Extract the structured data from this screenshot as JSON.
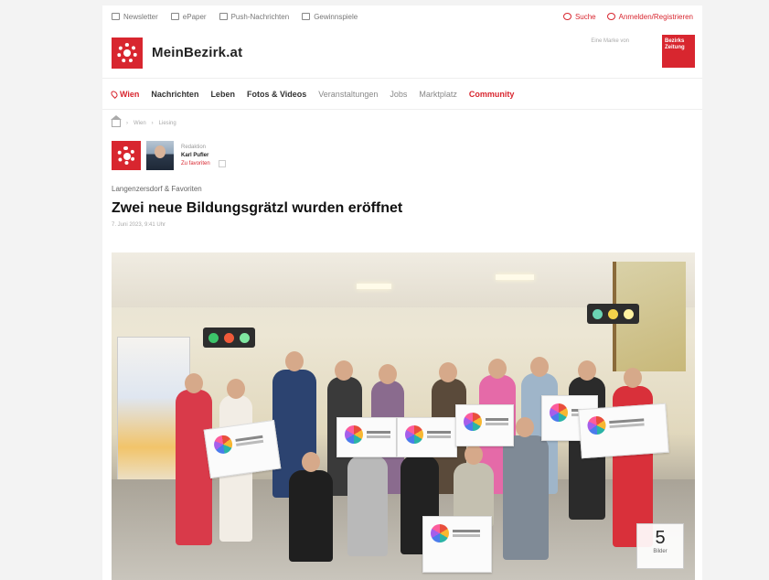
{
  "utility": {
    "newsletter": "Newsletter",
    "epaper": "ePaper",
    "push": "Push-Nachrichten",
    "games": "Gewinnspiele",
    "search": "Suche",
    "login": "Anmelden/Registrieren"
  },
  "brand": {
    "name": "MeinBezirk.at",
    "partner_text": "Eine Marke von",
    "badge": "Bezirks Zeitung",
    "accent": "#d8262f"
  },
  "nav": {
    "location": "Wien",
    "items": [
      "Nachrichten",
      "Leben",
      "Fotos & Videos",
      "Veranstaltungen",
      "Jobs",
      "Marktplatz",
      "Community"
    ]
  },
  "breadcrumb": [
    "Wien",
    "Liesing"
  ],
  "author": {
    "role": "Redaktion",
    "name": "Karl Pufler",
    "follow": "Zu favoriten"
  },
  "article": {
    "category": "Langenzersdorf & Favoriten",
    "headline": "Zwei neue Bildungsgrätzl wurden eröffnet",
    "date": "7. Juni 2023, 9:41 Uhr"
  },
  "gallery": {
    "count": "5",
    "label": "Bilder"
  }
}
